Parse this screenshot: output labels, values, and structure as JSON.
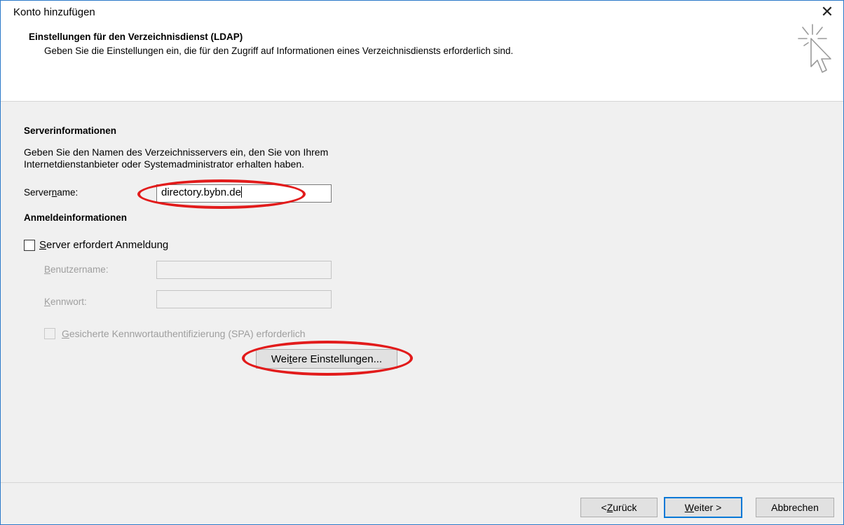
{
  "window": {
    "title": "Konto hinzufügen",
    "close_glyph": "✕"
  },
  "header": {
    "title": "Einstellungen für den Verzeichnisdienst (LDAP)",
    "subtitle": "Geben Sie die Einstellungen ein, die für den Zugriff auf Informationen eines Verzeichnisdiensts erforderlich sind.",
    "icon": "wizard-cursor-icon"
  },
  "server_info": {
    "section_title": "Serverinformationen",
    "description_line1": "Geben Sie den Namen des Verzeichnisservers ein, den Sie von Ihrem",
    "description_line2": "Internetdienstanbieter oder Systemadministrator erhalten haben.",
    "servername_label_pre": "Server",
    "servername_label_accel": "n",
    "servername_label_post": "ame:",
    "servername_value": "directory.bybn.de"
  },
  "login_info": {
    "section_title": "Anmeldeinformationen",
    "requires_login_accel": "S",
    "requires_login_rest": "erver erfordert Anmeldung",
    "requires_login_checked": false,
    "username_label_accel": "B",
    "username_label_rest": "enutzername:",
    "username_value": "",
    "password_label_accel": "K",
    "password_label_rest": "ennwort:",
    "password_value": "",
    "spa_accel": "G",
    "spa_rest": "esicherte Kennwortauthentifizierung (SPA) erforderlich",
    "spa_checked": false
  },
  "more_settings": {
    "label_pre": "Wei",
    "label_accel": "t",
    "label_post": "ere Einstellungen..."
  },
  "footer": {
    "back_pre": "< ",
    "back_accel": "Z",
    "back_post": "urück",
    "next_accel": "W",
    "next_post": "eiter >",
    "cancel": "Abbrechen"
  },
  "annotation_color": "#e21b1b"
}
